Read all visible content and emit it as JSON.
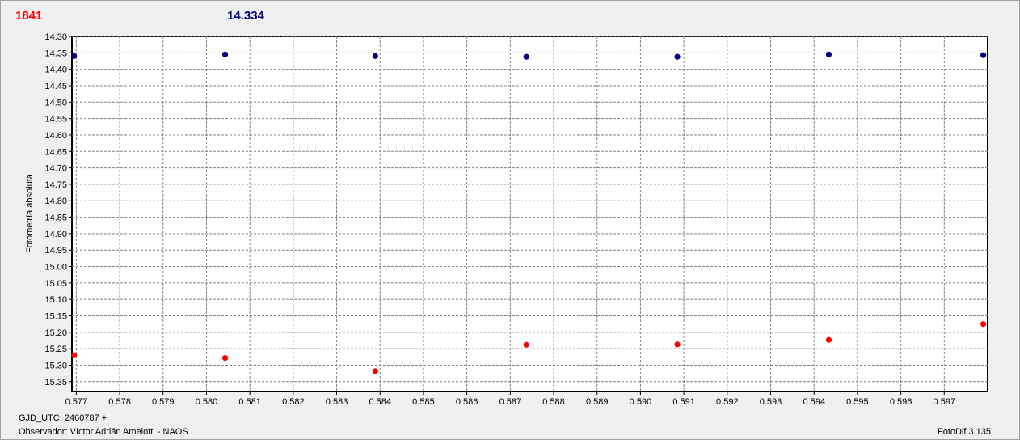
{
  "header": {
    "left_value": "1841",
    "right_value": "14.334"
  },
  "footer": {
    "gjd": "GJD_UTC: 2460787 +",
    "observer": "Observador: Víctor Adrián Amelotti - NAOS",
    "software": "FotoDif 3.135"
  },
  "colors": {
    "series_red": "#ff0000",
    "series_blue": "#000080",
    "grid": "#808080"
  },
  "chart_data": {
    "type": "scatter",
    "ylabel": "Fotometría absoluta",
    "xlabel": "",
    "x_ticks": [
      "0.577",
      "0.578",
      "0.579",
      "0.580",
      "0.581",
      "0.582",
      "0.583",
      "0.584",
      "0.585",
      "0.586",
      "0.587",
      "0.588",
      "0.589",
      "0.590",
      "0.591",
      "0.592",
      "0.593",
      "0.594",
      "0.595",
      "0.596",
      "0.597"
    ],
    "y_ticks": [
      "14.30",
      "14.35",
      "14.40",
      "14.45",
      "14.50",
      "14.55",
      "14.60",
      "14.65",
      "14.70",
      "14.75",
      "14.80",
      "14.85",
      "14.90",
      "14.95",
      "15.00",
      "15.05",
      "15.10",
      "15.15",
      "15.20",
      "15.25",
      "15.30",
      "15.35"
    ],
    "xlim": [
      0.5769,
      0.598
    ],
    "ylim": [
      14.3,
      15.38
    ],
    "y_inverted": true,
    "grid": true,
    "series": [
      {
        "color": "#000080",
        "x": [
          0.57695,
          0.58043,
          0.58389,
          0.58737,
          0.59085,
          0.59434,
          0.5979
        ],
        "y": [
          14.36,
          14.355,
          14.36,
          14.362,
          14.362,
          14.355,
          14.357
        ]
      },
      {
        "color": "#ff0000",
        "x": [
          0.57695,
          0.58043,
          0.58389,
          0.58737,
          0.59085,
          0.59434,
          0.5979
        ],
        "y": [
          15.27,
          15.278,
          15.318,
          15.238,
          15.237,
          15.223,
          15.175
        ]
      }
    ]
  }
}
